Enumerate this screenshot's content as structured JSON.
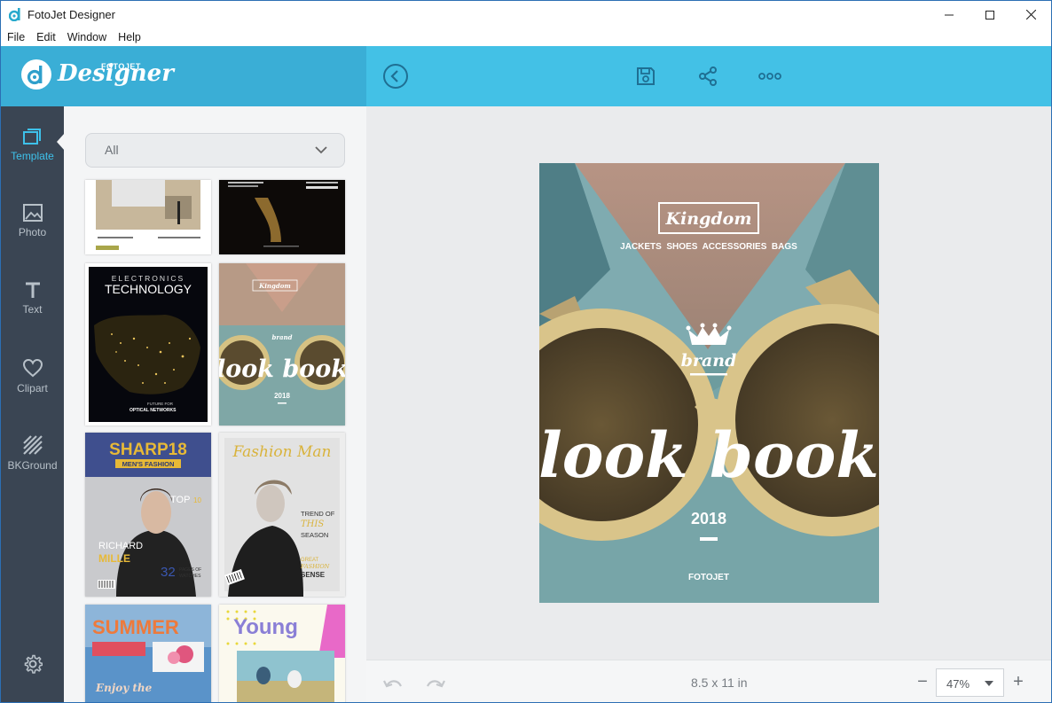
{
  "window": {
    "title": "FotoJet Designer"
  },
  "menu": [
    "File",
    "Edit",
    "Window",
    "Help"
  ],
  "logo": {
    "brand_small": "FOTOJET",
    "brand_large": "Designer"
  },
  "toolbar": {
    "back_icon": "arrow-left-circle-icon",
    "save_icon": "save-icon",
    "share_icon": "share-icon",
    "more_icon": "more-horizontal-icon"
  },
  "rail": [
    {
      "label": "Template",
      "icon": "template-icon",
      "active": true
    },
    {
      "label": "Photo",
      "icon": "photo-icon"
    },
    {
      "label": "Text",
      "icon": "text-icon"
    },
    {
      "label": "Clipart",
      "icon": "heart-icon"
    },
    {
      "label": "BKGround",
      "icon": "background-icon"
    }
  ],
  "settings_icon": "gear-icon",
  "category_filter": {
    "selected": "All"
  },
  "templates": [
    {
      "name": "office-desk"
    },
    {
      "name": "last-quarter"
    },
    {
      "texts": [
        "ELECTRONICS",
        "TECHNOLOGY",
        "FUTURE FOR",
        "OPTICAL NETWORKS"
      ]
    },
    {
      "texts": [
        "Kingdom",
        "brand",
        "look book",
        "2018"
      ]
    },
    {
      "texts": [
        "SHARP18",
        "MEN'S FASHION",
        "TOP",
        "10",
        "RICHARD",
        "MILLE",
        "32",
        "PAGES OF",
        "WATCHES"
      ]
    },
    {
      "texts": [
        "Fashion Man",
        "TREND OF",
        "THIS",
        "SEASON",
        "GREAT",
        "FASHION",
        "SENSE"
      ]
    },
    {
      "texts": [
        "SUMMER",
        "Enjoy the"
      ]
    },
    {
      "texts": [
        "Young"
      ]
    }
  ],
  "document": {
    "brand_box": "Kingdom",
    "categories": "JACKETS  SHOES  ACCESSORIES  BAGS",
    "brand": "brand",
    "headline": "look book",
    "year": "2018",
    "footer": "FOTOJET"
  },
  "bottom": {
    "page_size": "8.5 x 11 in",
    "zoom": "47%",
    "minus": "−",
    "plus": "+"
  },
  "colors": {
    "accent": "#43c1e6",
    "header_left": "#3aaed6",
    "rail": "#3a4553",
    "rail_active": "#3ec1ea"
  }
}
